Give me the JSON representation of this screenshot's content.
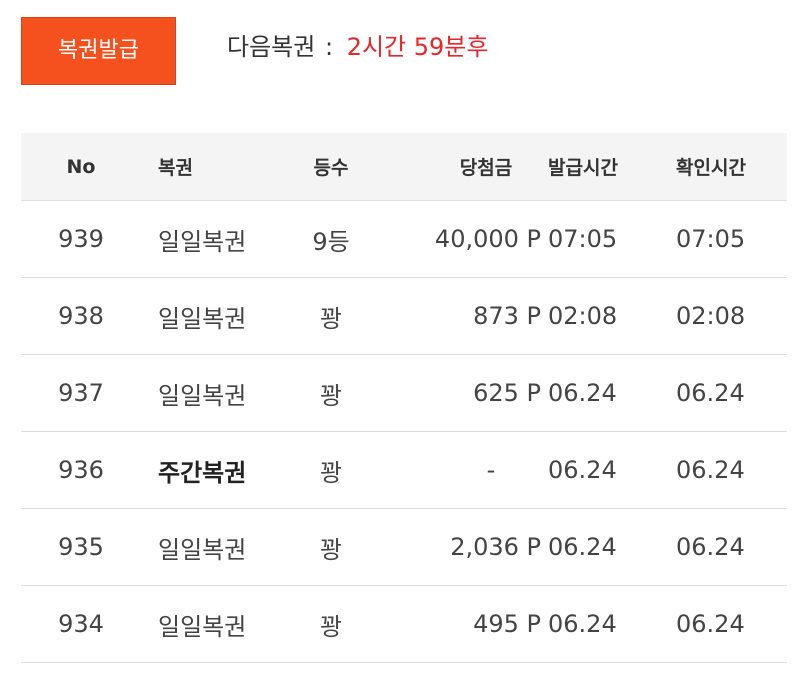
{
  "header": {
    "issue_button_label": "복권발급",
    "next_label": "다음복권",
    "next_colon": ":",
    "next_time": "2시간 59분후"
  },
  "colors": {
    "accent": "#f4511e",
    "countdown": "#e8262a",
    "header_bg": "#f4f4f4"
  },
  "table": {
    "headers": {
      "no": "No",
      "type": "복권",
      "rank": "등수",
      "prize": "당첨금",
      "issue_time": "발급시간",
      "check_time": "확인시간"
    },
    "rows": [
      {
        "no": "939",
        "type": "일일복권",
        "rank": "9등",
        "prize": "40,000 P",
        "issue_time": "07:05",
        "check_time": "07:05",
        "bold": false
      },
      {
        "no": "938",
        "type": "일일복권",
        "rank": "꽝",
        "prize": "873 P",
        "issue_time": "02:08",
        "check_time": "02:08",
        "bold": false
      },
      {
        "no": "937",
        "type": "일일복권",
        "rank": "꽝",
        "prize": "625 P",
        "issue_time": "06.24",
        "check_time": "06.24",
        "bold": false
      },
      {
        "no": "936",
        "type": "주간복권",
        "rank": "꽝",
        "prize": "-",
        "issue_time": "06.24",
        "check_time": "06.24",
        "bold": true
      },
      {
        "no": "935",
        "type": "일일복권",
        "rank": "꽝",
        "prize": "2,036 P",
        "issue_time": "06.24",
        "check_time": "06.24",
        "bold": false
      },
      {
        "no": "934",
        "type": "일일복권",
        "rank": "꽝",
        "prize": "495 P",
        "issue_time": "06.24",
        "check_time": "06.24",
        "bold": false
      }
    ]
  }
}
